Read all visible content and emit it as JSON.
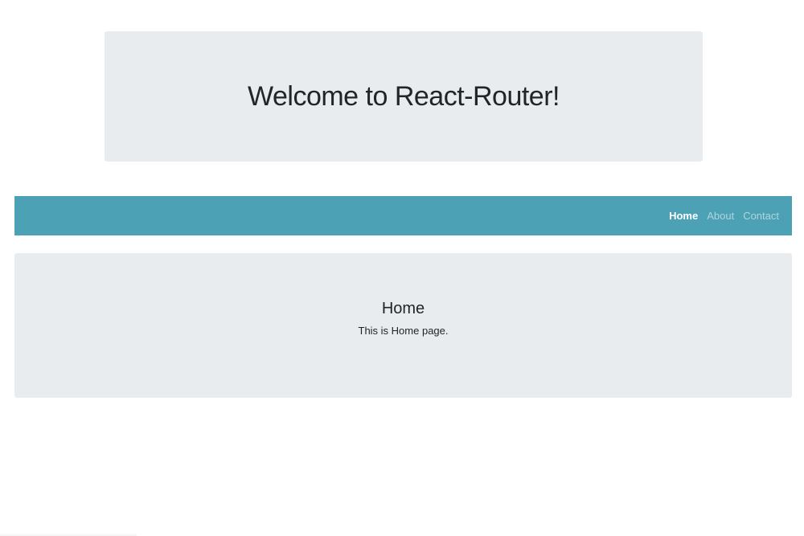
{
  "header": {
    "title": "Welcome to React-Router!"
  },
  "navbar": {
    "links": [
      {
        "label": "Home",
        "active": true
      },
      {
        "label": "About",
        "active": false
      },
      {
        "label": "Contact",
        "active": false
      }
    ],
    "background_color": "#4ca1b5",
    "active_color": "#ffffff"
  },
  "main": {
    "heading": "Home",
    "text": "This is Home page."
  }
}
